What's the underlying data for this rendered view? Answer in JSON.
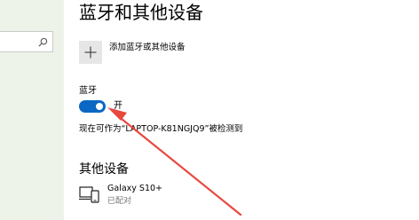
{
  "page": {
    "title": "蓝牙和其他设备"
  },
  "search": {
    "placeholder": ""
  },
  "add_device": {
    "label": "添加蓝牙或其他设备"
  },
  "bluetooth": {
    "label": "蓝牙",
    "enabled": true,
    "state_text": "开",
    "discoverable_text": "现在可作为“LAPTOP-K81NGJQ9”被检测到"
  },
  "other_devices": {
    "heading": "其他设备",
    "items": [
      {
        "name": "Galaxy S10+",
        "status": "已配对",
        "icon": "phone-laptop-icon"
      }
    ]
  },
  "annotation": {
    "color": "#e8483e"
  },
  "colors": {
    "accent": "#0a67c3",
    "sidebar_bg": "#eef3ea",
    "button_bg": "#e6e6e6"
  }
}
